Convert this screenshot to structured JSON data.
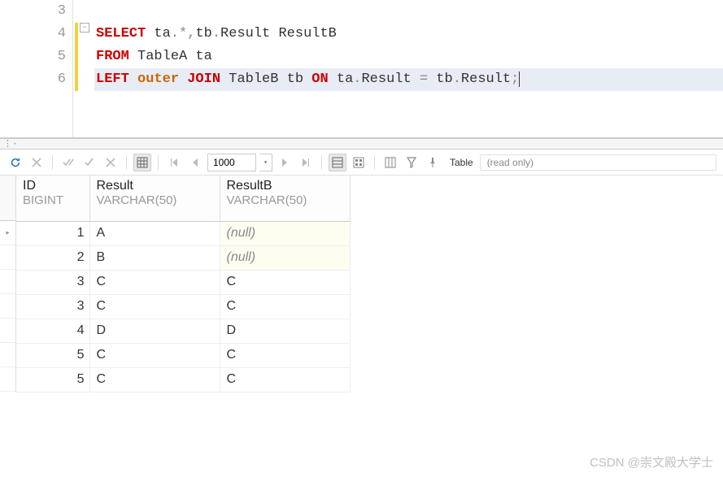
{
  "editor": {
    "lines": [
      {
        "num": "3",
        "tokens": []
      },
      {
        "num": "4",
        "tokens": [
          {
            "t": "SELECT",
            "c": "kw"
          },
          {
            "t": " ta",
            "c": "ident"
          },
          {
            "t": ".",
            "c": "op"
          },
          {
            "t": "*",
            "c": "op"
          },
          {
            "t": ",",
            "c": "op"
          },
          {
            "t": "tb",
            "c": "ident"
          },
          {
            "t": ".",
            "c": "op"
          },
          {
            "t": "Result ResultB",
            "c": "ident"
          }
        ]
      },
      {
        "num": "5",
        "tokens": [
          {
            "t": "FROM",
            "c": "kw"
          },
          {
            "t": " TableA ta",
            "c": "ident"
          }
        ]
      },
      {
        "num": "6",
        "active": true,
        "tokens": [
          {
            "t": "LEFT",
            "c": "kw"
          },
          {
            "t": " ",
            "c": ""
          },
          {
            "t": "outer",
            "c": "kw2"
          },
          {
            "t": " ",
            "c": ""
          },
          {
            "t": "JOIN",
            "c": "kw"
          },
          {
            "t": " TableB tb ",
            "c": "ident"
          },
          {
            "t": "ON",
            "c": "kw"
          },
          {
            "t": " ta",
            "c": "ident"
          },
          {
            "t": ".",
            "c": "op"
          },
          {
            "t": "Result ",
            "c": "ident"
          },
          {
            "t": "=",
            "c": "op"
          },
          {
            "t": " tb",
            "c": "ident"
          },
          {
            "t": ".",
            "c": "op"
          },
          {
            "t": "Result",
            "c": "ident"
          },
          {
            "t": ";",
            "c": "op"
          }
        ]
      }
    ]
  },
  "toolbar": {
    "row_limit": "1000",
    "mode_label": "Table",
    "status": "(read only)"
  },
  "grid": {
    "columns": [
      {
        "name": "ID",
        "type": "BIGINT"
      },
      {
        "name": "Result",
        "type": "VARCHAR(50)"
      },
      {
        "name": "ResultB",
        "type": "VARCHAR(50)"
      }
    ],
    "rows": [
      {
        "id": "1",
        "result": "A",
        "resultb": "(null)",
        "null_b": true,
        "marker": "▸"
      },
      {
        "id": "2",
        "result": "B",
        "resultb": "(null)",
        "null_b": true,
        "marker": ""
      },
      {
        "id": "3",
        "result": "C",
        "resultb": "C",
        "null_b": false,
        "marker": ""
      },
      {
        "id": "3",
        "result": "C",
        "resultb": "C",
        "null_b": false,
        "marker": ""
      },
      {
        "id": "4",
        "result": "D",
        "resultb": "D",
        "null_b": false,
        "marker": ""
      },
      {
        "id": "5",
        "result": "C",
        "resultb": "C",
        "null_b": false,
        "marker": ""
      },
      {
        "id": "5",
        "result": "C",
        "resultb": "C",
        "null_b": false,
        "marker": ""
      }
    ]
  },
  "watermark": "CSDN @崇文殿大学士"
}
